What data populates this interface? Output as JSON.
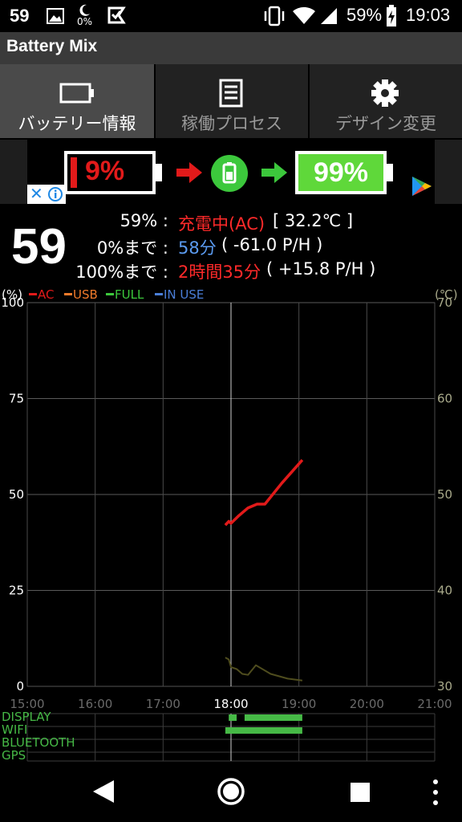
{
  "status_bar": {
    "time_left": "59",
    "moon_pct": "0%",
    "battery_pct": "59%",
    "clock": "19:03"
  },
  "app": {
    "title": "Battery Mix"
  },
  "tabs": [
    {
      "label": "バッテリー情報",
      "icon": "battery-icon",
      "active": true
    },
    {
      "label": "稼働プロセス",
      "icon": "list-icon",
      "active": false
    },
    {
      "label": "デザイン変更",
      "icon": "gear-icon",
      "active": false
    }
  ],
  "ad": {
    "low_pct": "9%",
    "high_pct": "99%"
  },
  "info": {
    "level": "59",
    "line1_prefix": "59% :",
    "line1_status": "充電中(AC)",
    "line1_temp": "[ 32.2℃ ]",
    "line2_label": "0%まで :",
    "line2_time": "58分",
    "line2_rate": "( -61.0 P/H )",
    "line3_label": "100%まで :",
    "line3_time": "2時間35分",
    "line3_rate": "( +15.8 P/H )"
  },
  "legend": {
    "left_unit": "(%)",
    "right_unit": "(℃)",
    "items": [
      {
        "label": "AC",
        "color": "#e21a1a"
      },
      {
        "label": "USB",
        "color": "#f07a2a"
      },
      {
        "label": "FULL",
        "color": "#3cc83c"
      },
      {
        "label": "IN USE",
        "color": "#4a7ed8"
      }
    ]
  },
  "chart_data": {
    "type": "line",
    "x_ticks": [
      "15:00",
      "16:00",
      "17:00",
      "18:00",
      "19:00",
      "20:00",
      "21:00"
    ],
    "current_x": "18:00",
    "xlim": [
      "15:00",
      "21:00"
    ],
    "y_left_ticks": [
      "0",
      "25",
      "50",
      "75",
      "100"
    ],
    "ylim_left": [
      0,
      100
    ],
    "y_right_ticks": [
      "30",
      "40",
      "50",
      "60",
      "70"
    ],
    "ylim_right": [
      30,
      70
    ],
    "grid": true,
    "series": [
      {
        "name": "AC",
        "axis": "left",
        "color": "#e21a1a",
        "points": [
          [
            "17:55",
            42
          ],
          [
            "17:58",
            43
          ],
          [
            "18:00",
            42.5
          ],
          [
            "18:07",
            44.5
          ],
          [
            "18:15",
            46.5
          ],
          [
            "18:23",
            47.5
          ],
          [
            "18:30",
            47.5
          ],
          [
            "18:45",
            53
          ],
          [
            "19:00",
            58
          ],
          [
            "19:03",
            59
          ]
        ]
      },
      {
        "axis": "right",
        "color": "#4f4d1e",
        "points": [
          [
            "17:55",
            33.0
          ],
          [
            "17:58",
            32.8
          ],
          [
            "18:00",
            32.0
          ],
          [
            "18:05",
            31.8
          ],
          [
            "18:10",
            31.3
          ],
          [
            "18:15",
            31.2
          ],
          [
            "18:22",
            32.2
          ],
          [
            "18:35",
            31.3
          ],
          [
            "18:50",
            30.8
          ],
          [
            "19:03",
            30.6
          ]
        ]
      }
    ]
  },
  "activity": {
    "labels": [
      "DISPLAY",
      "WIFI",
      "BLUETOOTH",
      "GPS"
    ],
    "color": "#46b946",
    "display_on": [
      [
        "17:58",
        "18:05"
      ],
      [
        "18:12",
        "19:03"
      ]
    ],
    "wifi_on": [
      [
        "17:55",
        "19:03"
      ]
    ],
    "bluetooth_on": [],
    "gps_on": []
  }
}
